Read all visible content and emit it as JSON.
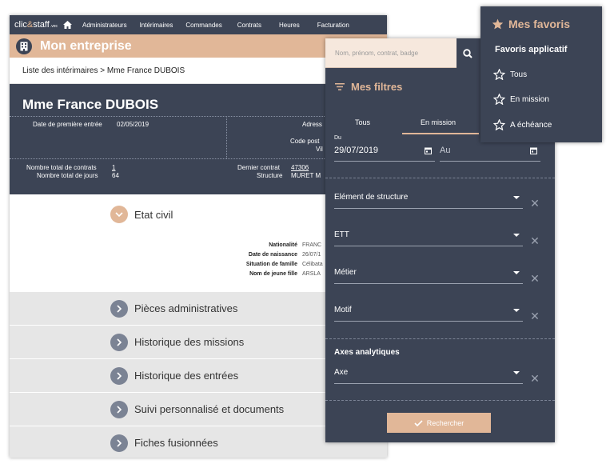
{
  "app": {
    "logo": {
      "part1": "clic",
      "amp": "&",
      "part2": "staff",
      "suffix": ".vec"
    },
    "nav": [
      "Administrateurs",
      "Intérimaires",
      "Commandes",
      "Contrats",
      "Heures",
      "Facturation"
    ],
    "company_title": "Mon entreprise",
    "breadcrumb": "Liste des intérimaires > Mme France DUBOIS"
  },
  "worker": {
    "name": "Mme France DUBOIS",
    "first_entry_label": "Date de première entrée",
    "first_entry_value": "02/05/2019",
    "address_label": "Adress",
    "postal_code_label": "Code post",
    "city_label": "Vil",
    "total_contracts_label": "Nombre total de contrats",
    "total_contracts_value": "1",
    "total_days_label": "Nombre total de jours",
    "total_days_value": "64",
    "last_contract_label": "Dernier contrat",
    "last_contract_value": "47306",
    "structure_label": "Structure",
    "structure_value": "MURET M"
  },
  "etat_civil": {
    "title": "Etat civil",
    "rows": [
      {
        "label": "Nationalité",
        "value": "FRANC"
      },
      {
        "label": "Date de naissance",
        "value": "26/07/1"
      },
      {
        "label": "Situation de famille",
        "value": "Célibata"
      },
      {
        "label": "Nom de jeune fille",
        "value": "ARSLA"
      }
    ]
  },
  "sections": [
    "Pièces administratives",
    "Historique des missions",
    "Historique des entrées",
    "Suivi personnalisé et documents",
    "Fiches fusionnées"
  ],
  "filters": {
    "search_placeholder": "Nom, prénom, contrat, badge",
    "title": "Mes filtres",
    "tabs": [
      "Tous",
      "En mission"
    ],
    "active_tab": "En mission",
    "du_label": "Du",
    "date_from": "29/07/2019",
    "date_to_placeholder": "Au",
    "selects": [
      "Elément de structure",
      "ETT",
      "Métier",
      "Motif"
    ],
    "axes_title": "Axes analytiques",
    "axe_select": "Axe",
    "search_button": "Rechercher"
  },
  "favorites": {
    "title": "Mes favoris",
    "subtitle": "Favoris applicatif",
    "items": [
      "Tous",
      "En mission",
      "A échéance"
    ]
  },
  "colors": {
    "navy": "#3c4455",
    "peach": "#e1b798",
    "light_grey": "#e6e6e6"
  }
}
